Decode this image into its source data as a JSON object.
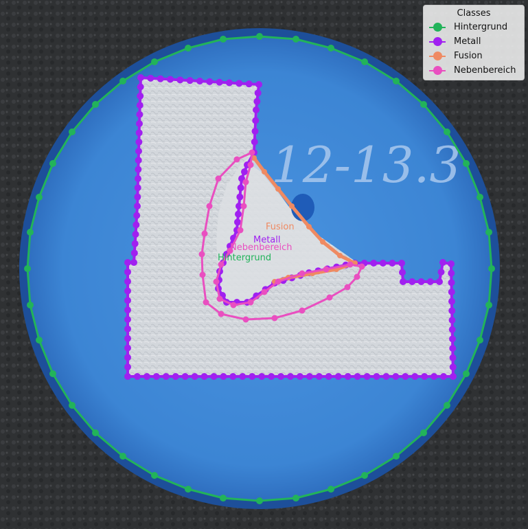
{
  "legend": {
    "title": "Classes",
    "items": [
      {
        "label": "Hintergrund",
        "color": "#22b35a"
      },
      {
        "label": "Metall",
        "color": "#a020f0"
      },
      {
        "label": "Fusion",
        "color": "#ef8a62"
      },
      {
        "label": "Nebenbereich",
        "color": "#e94fc0"
      }
    ]
  },
  "annotations": {
    "fusion": "Fusion",
    "metall": "Metall",
    "nebenbereich": "Nebenbereich",
    "hintergrund": "Hintergrund"
  },
  "specimen": {
    "engraving": "12-13.3"
  },
  "colors": {
    "background_surface": "#2f3133",
    "disc_blue": "#3f8ad8",
    "disc_rim": "#1d4f9a",
    "metal_gray": "#d2d6da"
  }
}
